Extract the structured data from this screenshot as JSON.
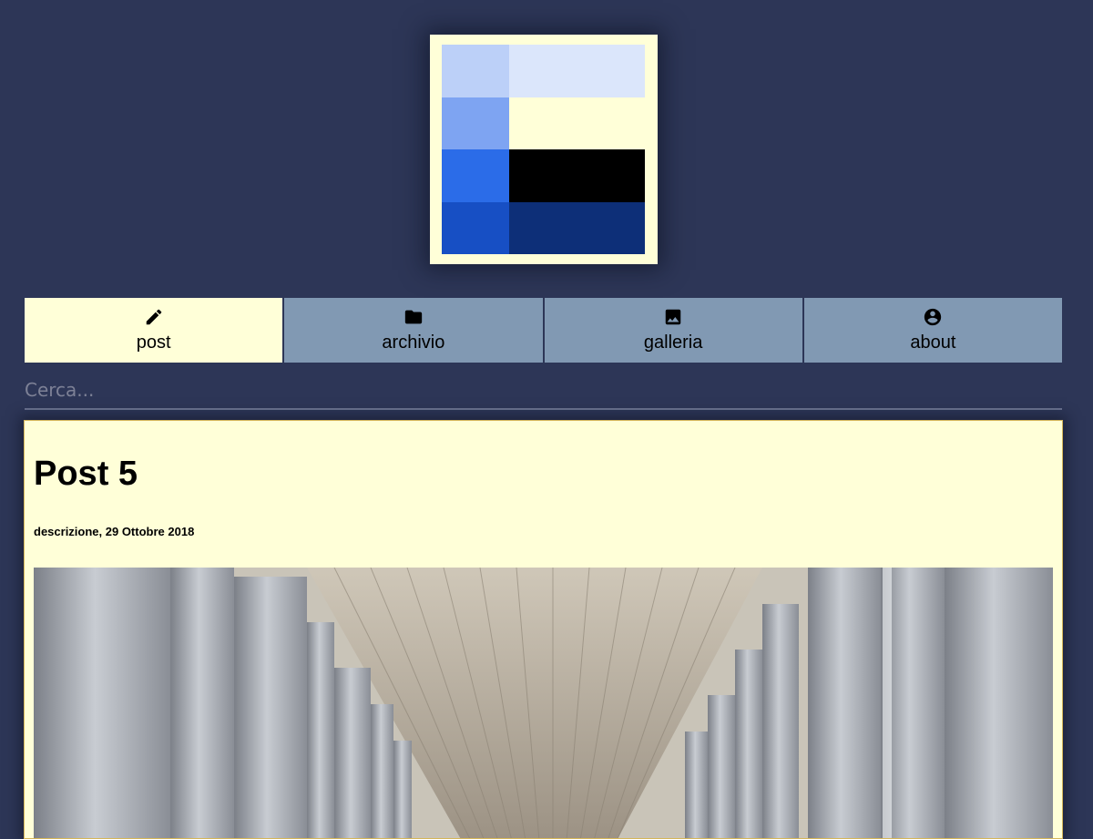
{
  "logo": {
    "colors": [
      "#bcd0f8",
      "#dbe6fb",
      "#7ea4f2",
      "#ffffd8",
      "#2b6ce8",
      "#000000",
      "#174fc4",
      "#0d2f78"
    ]
  },
  "nav": {
    "items": [
      {
        "label": "post",
        "icon": "pencil-icon",
        "active": true
      },
      {
        "label": "archivio",
        "icon": "folder-icon",
        "active": false
      },
      {
        "label": "galleria",
        "icon": "image-icon",
        "active": false
      },
      {
        "label": "about",
        "icon": "account-circle-icon",
        "active": false
      }
    ]
  },
  "search": {
    "placeholder": "Cerca...",
    "value": ""
  },
  "post": {
    "title": "Post 5",
    "meta": "descrizione, 29 Ottobre 2018",
    "image": "colonnade-photo"
  },
  "colors": {
    "background": "#2d3657",
    "active_tab": "#ffffd8",
    "inactive_tab": "#8199b3",
    "card": "#ffffd8"
  }
}
